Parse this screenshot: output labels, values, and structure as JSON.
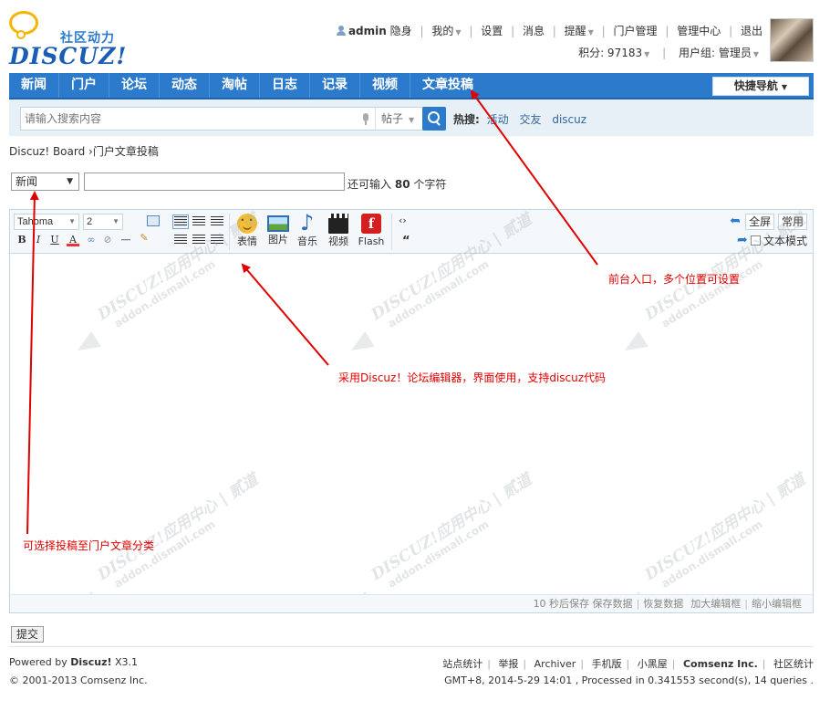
{
  "header": {
    "logo_sub": "社区动力",
    "logo_main": "DISCUZ!",
    "user_links": [
      "admin",
      "隐身",
      "我的",
      "设置",
      "消息",
      "提醒",
      "门户管理",
      "管理中心",
      "退出"
    ],
    "points": "积分: 97183",
    "user_group": "用户组: 管理员"
  },
  "nav": {
    "items": [
      "新闻",
      "门户",
      "论坛",
      "动态",
      "淘帖",
      "日志",
      "记录",
      "视频",
      "文章投稿"
    ],
    "quick_nav": "快捷导航"
  },
  "search": {
    "placeholder": "请输入搜索内容",
    "type": "帖子",
    "hot_label": "热搜:",
    "hot_terms": [
      "活动",
      "交友",
      "discuz"
    ]
  },
  "breadcrumb": "Discuz! Board ›门户文章投稿",
  "form": {
    "category": "新闻",
    "char_hint_prefix": "还可输入",
    "char_count": "80",
    "char_hint_suffix": "个字符"
  },
  "editor": {
    "font": "Tahoma",
    "size": "2",
    "buttons": [
      "表情",
      "图片",
      "音乐",
      "视频",
      "Flash"
    ],
    "fullscreen": "全屏",
    "common": "常用",
    "text_mode": "文本模式",
    "status": [
      "10 秒后保存 保存数据",
      "恢复数据",
      "加大编辑框",
      "缩小编辑框"
    ],
    "watermark_line1": "DISCUZ!应用中心 | 贰道",
    "watermark_line2": "addon.dismall.com"
  },
  "annotations": {
    "entry": "前台入口，多个位置可设置",
    "editor": "采用Discuz！论坛编辑器，界面使用，支持discuz代码",
    "category": "可选择投稿至门户文章分类"
  },
  "submit_label": "提交",
  "footer": {
    "powered_prefix": "Powered by",
    "powered_brand": "Discuz!",
    "powered_ver": "X3.1",
    "copyright": "© 2001-2013 Comsenz Inc.",
    "links": [
      "站点统计",
      "举报",
      "Archiver",
      "手机版",
      "小黑屋",
      "Comsenz Inc.",
      "社区统计"
    ],
    "info": "GMT+8, 2014-5-29 14:01 , Processed in 0.341553 second(s), 14 queries ."
  },
  "colors": {
    "nav_bg": "#2b7acb",
    "annotation": "#e00000"
  }
}
